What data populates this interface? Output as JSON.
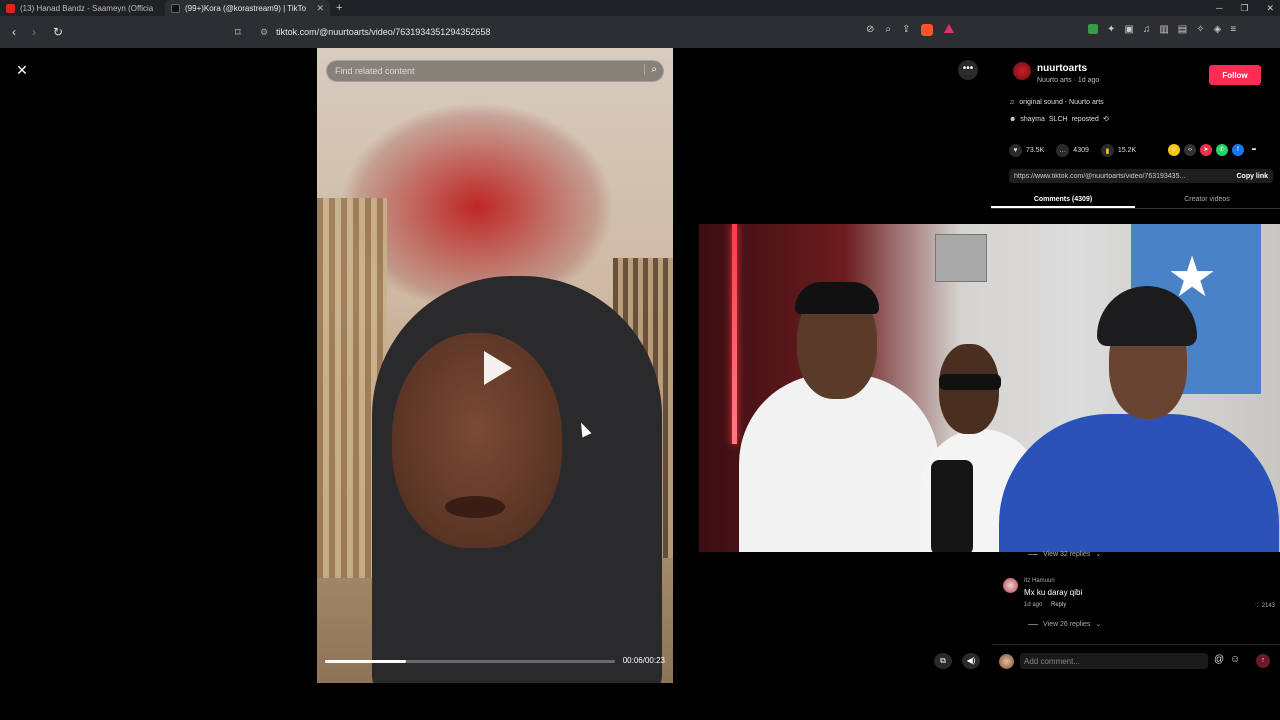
{
  "browser": {
    "tabs": [
      {
        "label": "(13) Hanad Bandz - Saameyn (Officia",
        "favicon": "youtube"
      },
      {
        "label": "(99+)Kora (@korastream9) | TikTo",
        "favicon": "tiktok"
      }
    ],
    "new_tab": "+",
    "url": "tiktok.com/@nuurtoarts/video/7631934351294352658"
  },
  "video": {
    "search_placeholder": "Find related content",
    "time": "00:06/00:23",
    "progress": 0.28
  },
  "author": {
    "username": "nuurtoarts",
    "meta": "Nuurto arts · 1d ago",
    "follow_label": "Follow"
  },
  "sound": "original sound - Nuurto arts",
  "repost": {
    "user": "shayma",
    "suffix": "SLCH",
    "label": "reposted"
  },
  "stats": {
    "likes": "73.5K",
    "comments": "4309",
    "saves": "15.2K"
  },
  "link": {
    "url": "https://www.tiktok.com/@nuurtoarts/video/763193435...",
    "copy_label": "Copy link"
  },
  "panel_tabs": [
    {
      "label": "Comments (4309)",
      "active": true
    },
    {
      "label": "Creator videos",
      "active": false
    }
  ],
  "comments": {
    "replies_top": "View 32 replies",
    "items": [
      {
        "user": "Itz Hamuun",
        "text": "Mx ku daray qibi",
        "date": "1d ago",
        "reply": "Reply",
        "likes": "2143"
      }
    ],
    "replies_bottom": "View 26 replies",
    "input_placeholder": "Add comment..."
  },
  "colors": {
    "follow": "#fe2c55",
    "background": "#000000"
  }
}
